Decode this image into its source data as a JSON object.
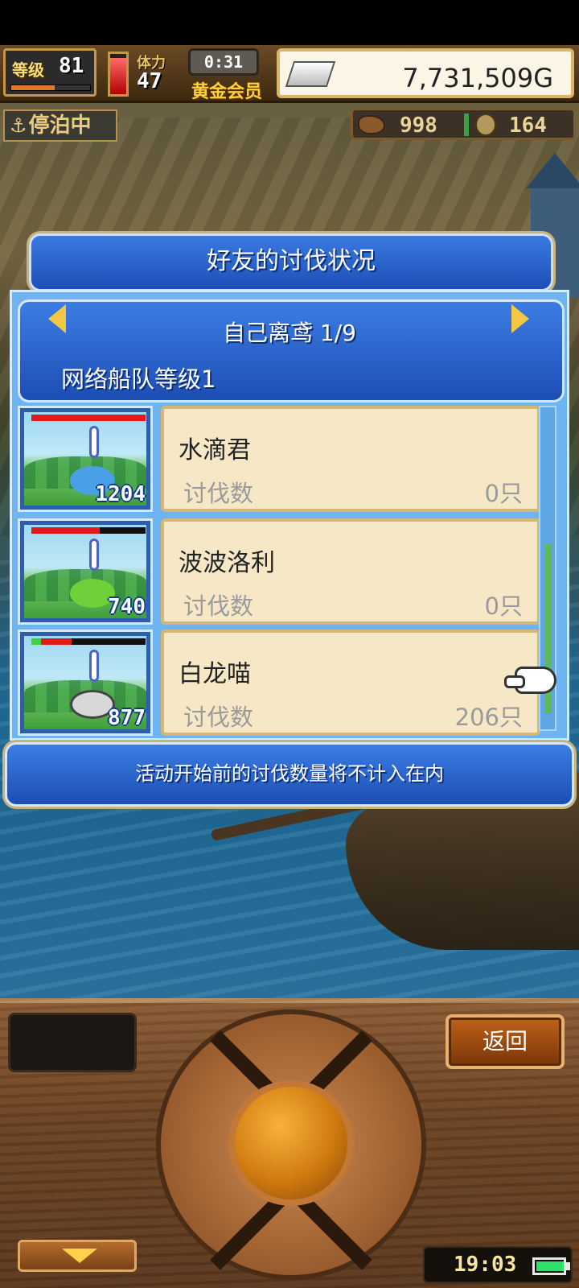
{
  "hud": {
    "level_label": "等级",
    "level_value": "81",
    "xp_fraction": 0.55,
    "stamina_label": "体力",
    "stamina_value": "47",
    "stamina_fraction": 0.9,
    "timer": "0:31",
    "member_label": "黄金会员",
    "gold": "7,731,509G",
    "status_label": "停泊中",
    "resource_1_value": "998",
    "resource_2_value": "164"
  },
  "dialog": {
    "title": "好友的讨伐状况",
    "page_label": "自己离鸢 1/9",
    "fleet_level": "网络船队等级1",
    "footer_note": "活动开始前的讨伐数量将不计入在内"
  },
  "rows": [
    {
      "name": "水滴君",
      "count_label": "讨伐数",
      "count": "0只",
      "thumb_number": "1204",
      "hp_fraction": 1.0
    },
    {
      "name": "波波洛利",
      "count_label": "讨伐数",
      "count": "0只",
      "thumb_number": "740",
      "hp_fraction": 0.6
    },
    {
      "name": "白龙喵",
      "count_label": "讨伐数",
      "count": "206只",
      "thumb_number": "877",
      "hp_fraction": 0.35
    }
  ],
  "controls": {
    "back_label": "返回",
    "clock": "19:03"
  },
  "colors": {
    "dialog_blue": "#1d4fb7",
    "card_cream": "#f6e8c6",
    "gold_accent": "#f2c744",
    "hp_red": "#e21919"
  }
}
